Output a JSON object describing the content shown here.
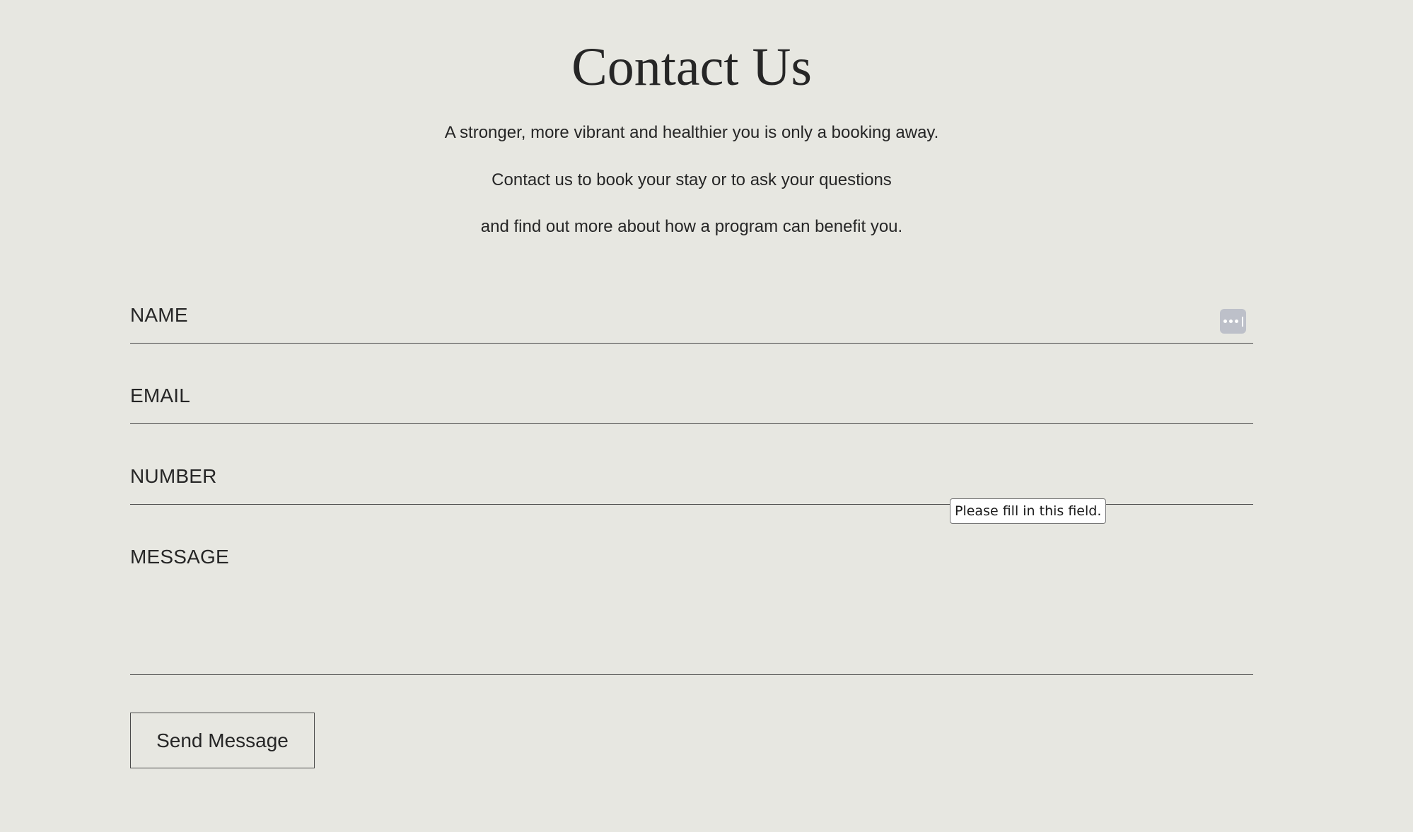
{
  "header": {
    "title": "Contact Us"
  },
  "intro": {
    "line1": "A stronger, more vibrant and healthier you is only a booking away.",
    "line2": "Contact us to book your stay or to ask your questions",
    "line3": "and find out more about how a program can benefit you."
  },
  "form": {
    "name_placeholder": "NAME",
    "email_placeholder": "EMAIL",
    "number_placeholder": "NUMBER",
    "message_placeholder": "MESSAGE",
    "submit_label": "Send Message",
    "validation_tooltip": "Please fill in this field."
  },
  "icons": {
    "password_manager": "password-manager-icon"
  },
  "colors": {
    "background": "#e7e7e1",
    "text": "#262626",
    "underline": "#4a4a4a",
    "autofill_icon_bg": "#bdc0c9"
  }
}
